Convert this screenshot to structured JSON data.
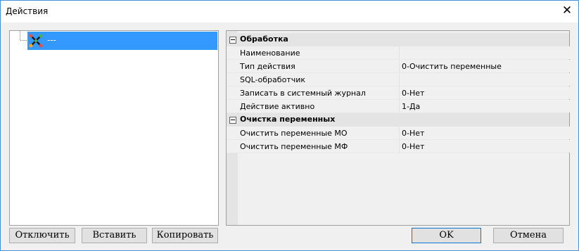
{
  "window": {
    "title": "Действия"
  },
  "tree": {
    "items": [
      {
        "label": "---"
      }
    ]
  },
  "properties": {
    "groups": [
      {
        "name": "Обработка",
        "rows": [
          {
            "name": "Наименование",
            "value": ""
          },
          {
            "name": "Тип действия",
            "value": "0-Очистить переменные"
          },
          {
            "name": "SQL-обработчик",
            "value": ""
          },
          {
            "name": "Записать в системный журнал",
            "value": "0-Нет"
          },
          {
            "name": "Действие активно",
            "value": "1-Да"
          }
        ]
      },
      {
        "name": "Очистка переменных",
        "rows": [
          {
            "name": "Очистить переменные МО",
            "value": "0-Нет"
          },
          {
            "name": "Очистить переменные МФ",
            "value": "0-Нет"
          }
        ]
      }
    ]
  },
  "buttons": {
    "disable": "Отключить",
    "paste": "Вставить",
    "copy": "Копировать",
    "ok": "OK",
    "cancel": "Отмена"
  }
}
